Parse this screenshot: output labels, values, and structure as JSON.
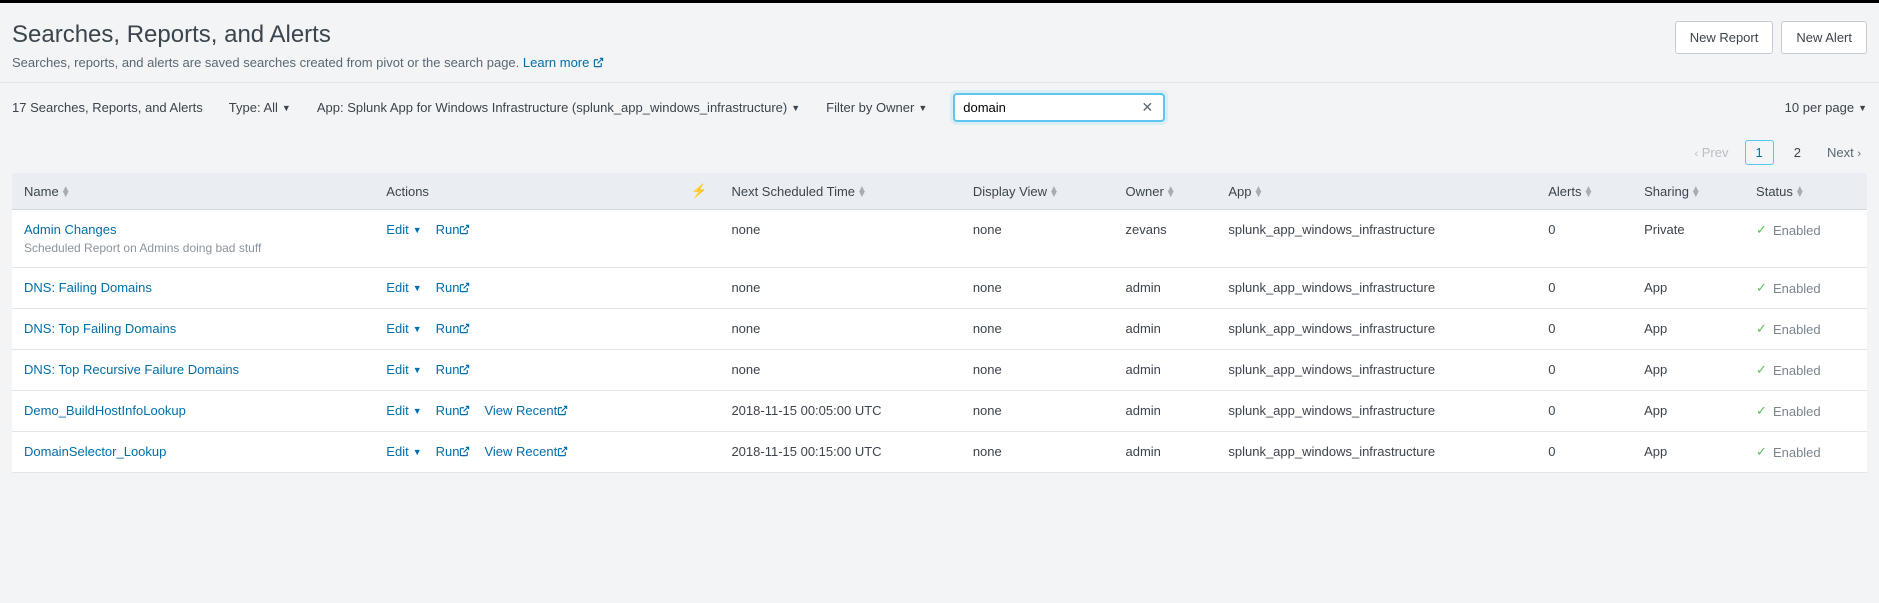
{
  "header": {
    "title": "Searches, Reports, and Alerts",
    "description": "Searches, reports, and alerts are saved searches created from pivot or the search page. ",
    "learn_more": "Learn more",
    "new_report": "New Report",
    "new_alert": "New Alert"
  },
  "filters": {
    "count_label": "17 Searches, Reports, and Alerts",
    "type_label": "Type: All",
    "app_label": "App: Splunk App for Windows Infrastructure (splunk_app_windows_infrastructure)",
    "owner_label": "Filter by Owner",
    "search_value": "domain",
    "per_page": "10 per page"
  },
  "pagination": {
    "prev": "Prev",
    "page1": "1",
    "page2": "2",
    "next": "Next"
  },
  "columns": {
    "name": "Name",
    "actions": "Actions",
    "next_scheduled": "Next Scheduled Time",
    "display_view": "Display View",
    "owner": "Owner",
    "app": "App",
    "alerts": "Alerts",
    "sharing": "Sharing",
    "status": "Status"
  },
  "actions": {
    "edit": "Edit",
    "run": "Run",
    "view_recent": "View Recent"
  },
  "status_enabled": "Enabled",
  "rows": [
    {
      "name": "Admin Changes",
      "subtitle": "Scheduled Report on Admins doing bad stuff",
      "has_view_recent": false,
      "next_scheduled": "none",
      "display_view": "none",
      "owner": "zevans",
      "app": "splunk_app_windows_infrastructure",
      "alerts": "0",
      "sharing": "Private"
    },
    {
      "name": "DNS: Failing Domains",
      "subtitle": "",
      "has_view_recent": false,
      "next_scheduled": "none",
      "display_view": "none",
      "owner": "admin",
      "app": "splunk_app_windows_infrastructure",
      "alerts": "0",
      "sharing": "App"
    },
    {
      "name": "DNS: Top Failing Domains",
      "subtitle": "",
      "has_view_recent": false,
      "next_scheduled": "none",
      "display_view": "none",
      "owner": "admin",
      "app": "splunk_app_windows_infrastructure",
      "alerts": "0",
      "sharing": "App"
    },
    {
      "name": "DNS: Top Recursive Failure Domains",
      "subtitle": "",
      "has_view_recent": false,
      "next_scheduled": "none",
      "display_view": "none",
      "owner": "admin",
      "app": "splunk_app_windows_infrastructure",
      "alerts": "0",
      "sharing": "App"
    },
    {
      "name": "Demo_BuildHostInfoLookup",
      "subtitle": "",
      "has_view_recent": true,
      "next_scheduled": "2018-11-15 00:05:00 UTC",
      "display_view": "none",
      "owner": "admin",
      "app": "splunk_app_windows_infrastructure",
      "alerts": "0",
      "sharing": "App"
    },
    {
      "name": "DomainSelector_Lookup",
      "subtitle": "",
      "has_view_recent": true,
      "next_scheduled": "2018-11-15 00:15:00 UTC",
      "display_view": "none",
      "owner": "admin",
      "app": "splunk_app_windows_infrastructure",
      "alerts": "0",
      "sharing": "App"
    }
  ]
}
